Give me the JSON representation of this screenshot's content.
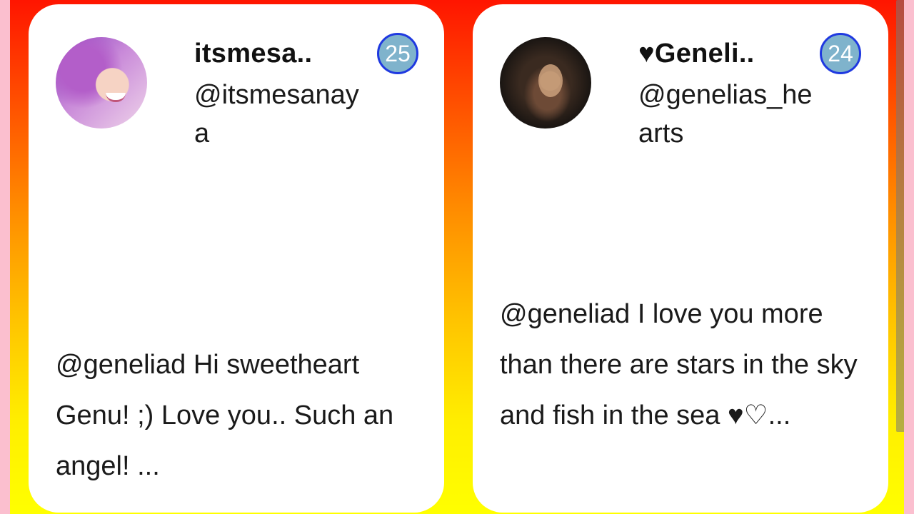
{
  "cards": [
    {
      "name": "itsmesa..",
      "handle": "@itsmesanaya",
      "badge": "25",
      "text": "@geneliad Hi sweetheart Genu! ;) Love you.. Such an angel! ..."
    },
    {
      "name": "♥Geneli..",
      "handle": "@genelias_hearts",
      "badge": "24",
      "text": "@geneliad I love you more than there are stars in the sky and fish in the sea ♥♡..."
    }
  ],
  "colors": {
    "gradient_top": "#ff1500",
    "gradient_bottom": "#ffff00",
    "side_border": "#fbbfcf",
    "badge_fill": "#7fb3cc",
    "badge_border": "#1f39e0"
  }
}
